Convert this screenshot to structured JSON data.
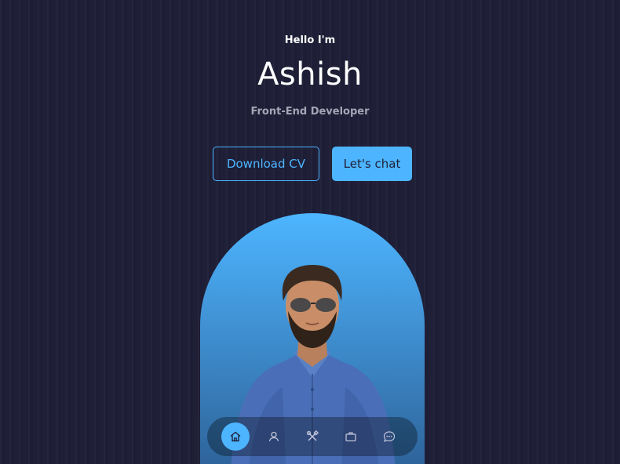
{
  "hero": {
    "greeting": "Hello I'm",
    "name": "Ashish",
    "role": "Front-End Developer"
  },
  "actions": {
    "download_cv": "Download CV",
    "lets_chat": "Let's chat"
  },
  "nav": {
    "items": [
      {
        "icon": "home-icon",
        "active": true
      },
      {
        "icon": "user-icon",
        "active": false
      },
      {
        "icon": "tools-icon",
        "active": false
      },
      {
        "icon": "briefcase-icon",
        "active": false
      },
      {
        "icon": "chat-icon",
        "active": false
      }
    ]
  },
  "colors": {
    "background": "#1f1f38",
    "accent": "#4db5ff",
    "muted_text": "#a5a5b5"
  }
}
